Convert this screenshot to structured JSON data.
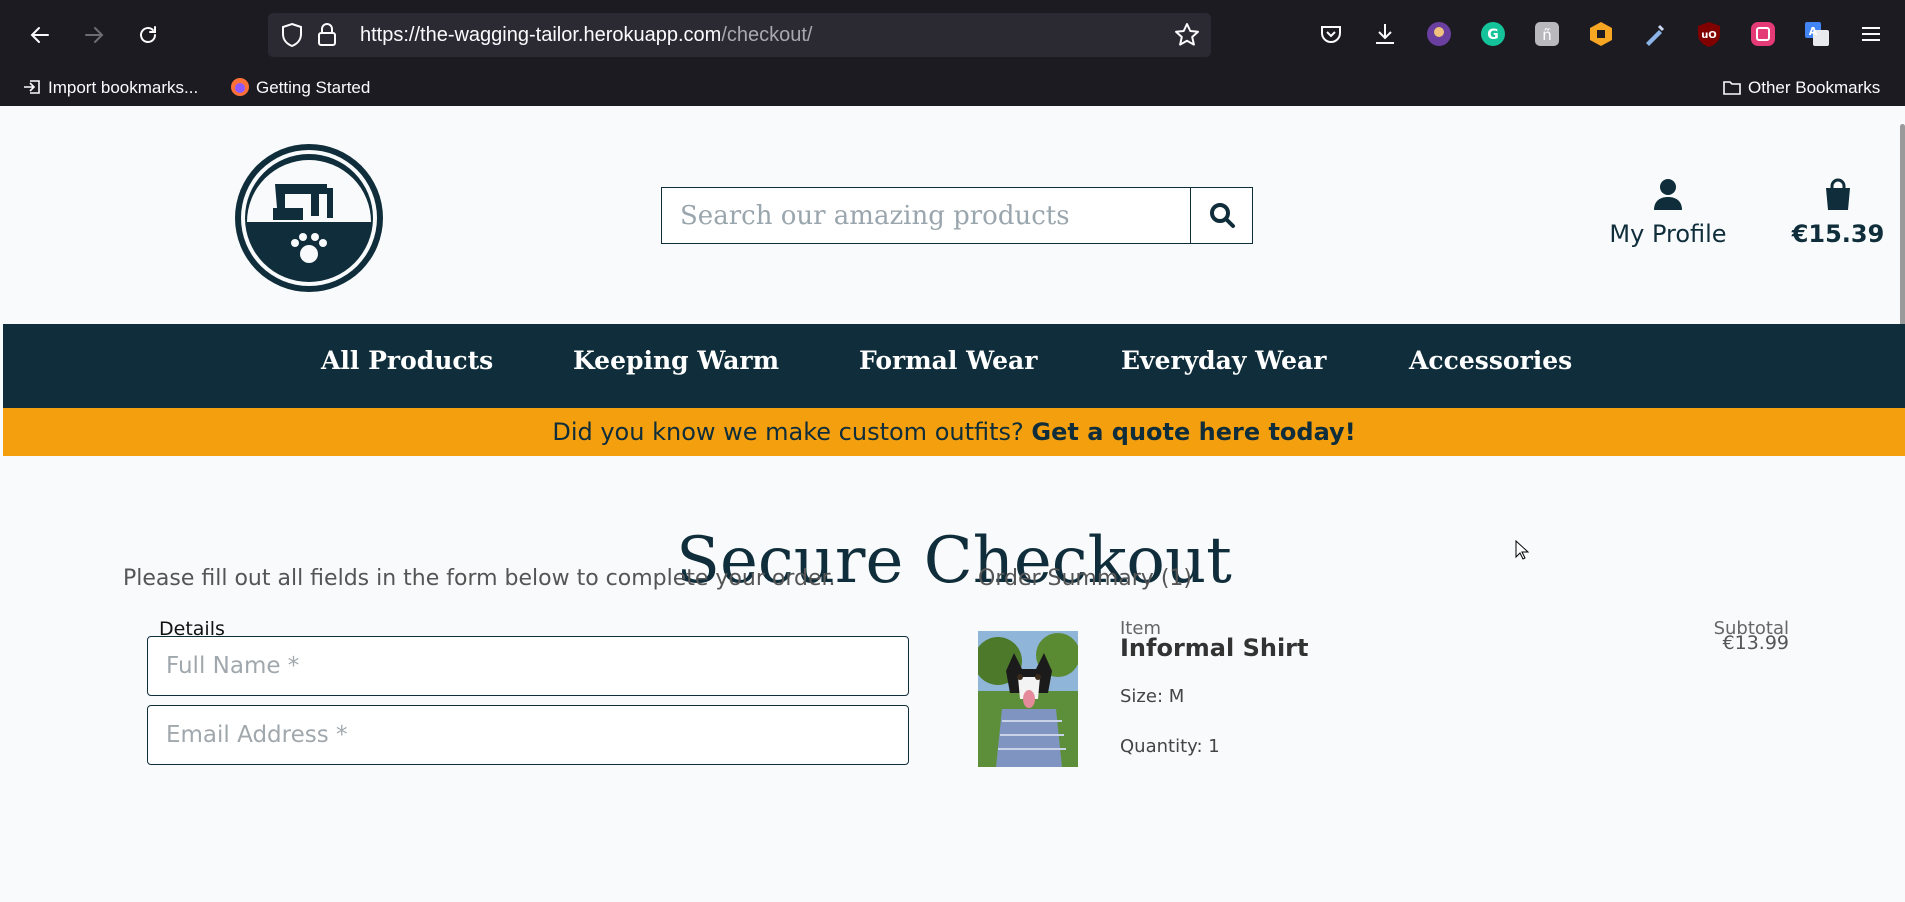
{
  "browser": {
    "url_host": "https://the-wagging-tailor.herokuapp.com",
    "url_path": "/checkout/",
    "bookmarks": {
      "import_label": "Import bookmarks...",
      "getting_started_label": "Getting Started",
      "other_label": "Other Bookmarks"
    }
  },
  "header": {
    "search_placeholder": "Search our amazing products",
    "profile_label": "My Profile",
    "bag_total": "€15.39"
  },
  "nav": {
    "items": [
      "All Products",
      "Keeping Warm",
      "Formal Wear",
      "Everyday Wear",
      "Accessories"
    ]
  },
  "banner": {
    "text": "Did you know we make custom outfits?",
    "link": "Get a quote here today!"
  },
  "checkout": {
    "title": "Secure Checkout",
    "intro": "Please fill out all fields in the form below to complete your order.",
    "details_legend": "Details",
    "full_name_placeholder": "Full Name *",
    "email_placeholder": "Email Address *"
  },
  "summary": {
    "title": "Order Summary (1)",
    "col_item": "Item",
    "col_subtotal": "Subtotal",
    "items": [
      {
        "name": "Informal Shirt",
        "size": "Size: M",
        "quantity": "Quantity: 1",
        "subtotal": "€13.99"
      }
    ]
  },
  "colors": {
    "brand_dark": "#0f2d3a",
    "banner": "#f4a00e",
    "chrome": "#1c1b22"
  }
}
